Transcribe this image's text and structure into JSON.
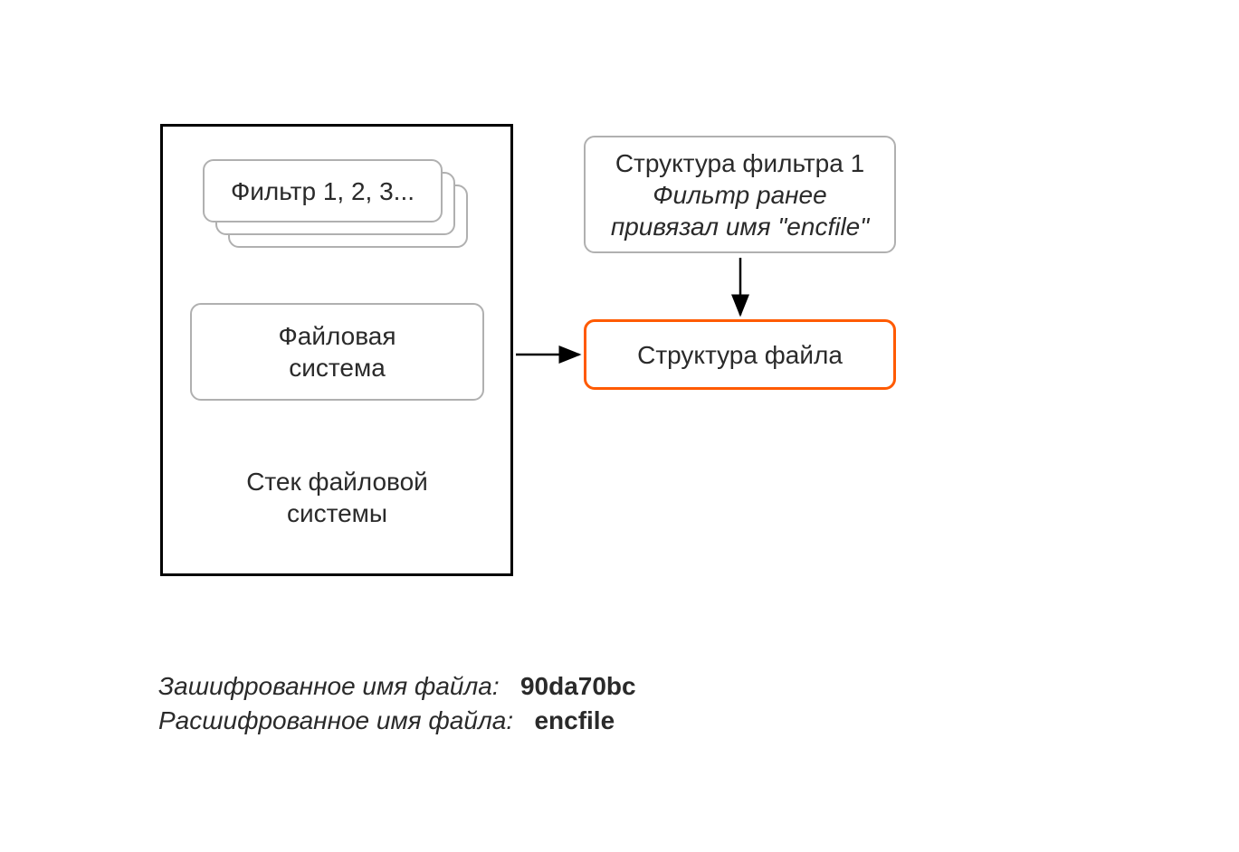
{
  "filtersBox": "Фильтр 1, 2, 3...",
  "fileSystemBox": {
    "line1": "Файловая",
    "line2": "система"
  },
  "stackCaption": {
    "line1": "Стек файловой",
    "line2": "системы"
  },
  "filterStruct": {
    "title": "Структура фильтра 1",
    "note1": "Фильтр ранее",
    "note2": "привязал имя \"encfile\""
  },
  "fileStruct": "Структура файла",
  "footer": {
    "encLabel": "Зашифрованное имя файла:",
    "encValue": "90da70bc",
    "decLabel": "Расшифрованное имя файла:",
    "decValue": "encfile"
  },
  "colors": {
    "orange": "#ff5a00",
    "gray": "#b0b0b0",
    "black": "#000000"
  }
}
